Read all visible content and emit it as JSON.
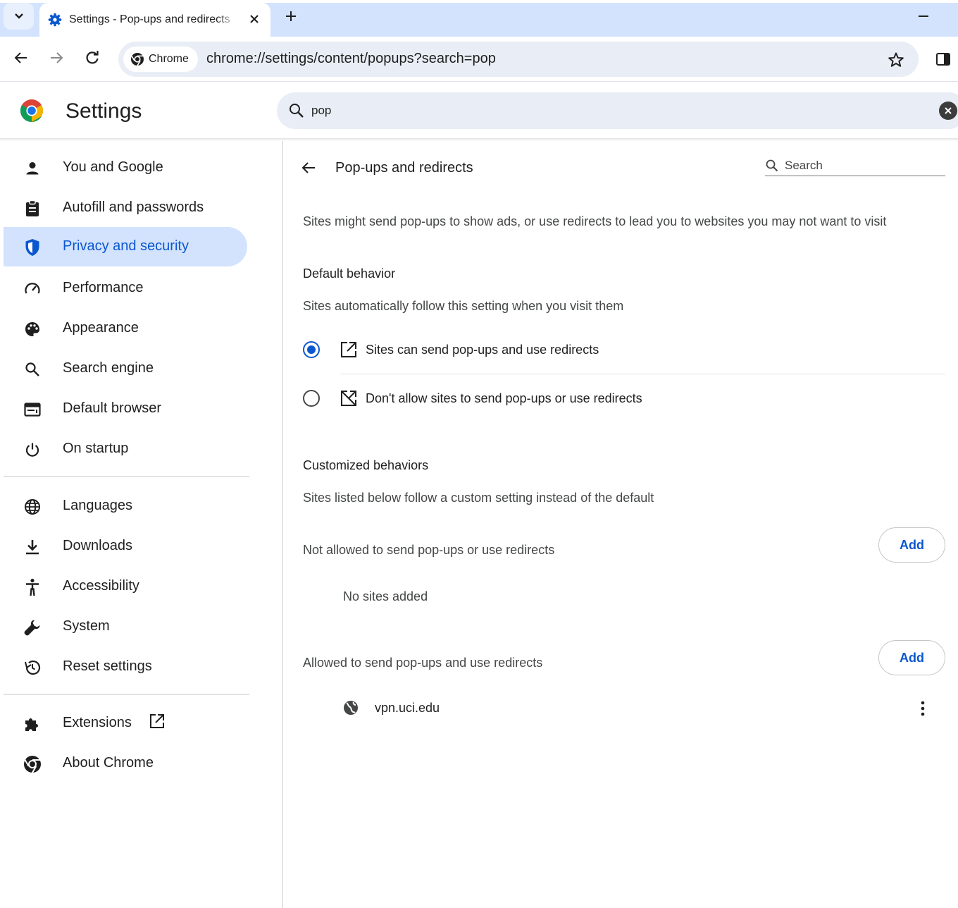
{
  "tab": {
    "title": "Settings - Pop-ups and redirects"
  },
  "omnibox": {
    "chip_label": "Chrome",
    "url": "chrome://settings/content/popups?search=pop"
  },
  "header": {
    "title": "Settings",
    "search_value": "pop"
  },
  "sidebar": {
    "items": [
      {
        "label": "You and Google",
        "icon": "person-icon"
      },
      {
        "label": "Autofill and passwords",
        "icon": "clipboard-icon"
      },
      {
        "label": "Privacy and security",
        "icon": "shield-icon",
        "active": true
      },
      {
        "label": "Performance",
        "icon": "speedometer-icon"
      },
      {
        "label": "Appearance",
        "icon": "palette-icon"
      },
      {
        "label": "Search engine",
        "icon": "search-icon"
      },
      {
        "label": "Default browser",
        "icon": "browser-window-icon"
      },
      {
        "label": "On startup",
        "icon": "power-icon"
      },
      {
        "label": "Languages",
        "icon": "globe-icon"
      },
      {
        "label": "Downloads",
        "icon": "download-icon"
      },
      {
        "label": "Accessibility",
        "icon": "accessibility-icon"
      },
      {
        "label": "System",
        "icon": "wrench-icon"
      },
      {
        "label": "Reset settings",
        "icon": "restore-icon"
      },
      {
        "label": "Extensions",
        "icon": "puzzle-icon"
      },
      {
        "label": "About Chrome",
        "icon": "chrome-icon"
      }
    ]
  },
  "main": {
    "title": "Pop-ups and redirects",
    "search_placeholder": "Search",
    "description": "Sites might send pop-ups to show ads, or use redirects to lead you to websites you may not want to visit",
    "default_behavior": {
      "heading": "Default behavior",
      "subtext": "Sites automatically follow this setting when you visit them",
      "options": [
        {
          "label": "Sites can send pop-ups and use redirects",
          "selected": true,
          "icon": "open-in-new-icon"
        },
        {
          "label": "Don't allow sites to send pop-ups or use redirects",
          "selected": false,
          "icon": "popup-blocked-icon"
        }
      ]
    },
    "customized": {
      "heading": "Customized behaviors",
      "subtext": "Sites listed below follow a custom setting instead of the default",
      "blocked": {
        "heading": "Not allowed to send pop-ups or use redirects",
        "add_label": "Add",
        "empty_text": "No sites added"
      },
      "allowed": {
        "heading": "Allowed to send pop-ups and use redirects",
        "add_label": "Add",
        "sites": [
          "vpn.uci.edu"
        ]
      }
    }
  },
  "colors": {
    "accent": "#0b57d0",
    "active_nav_bg": "#d3e3fd",
    "tabstrip_bg": "#d3e3fd",
    "omnibox_bg": "#e9eef6"
  }
}
